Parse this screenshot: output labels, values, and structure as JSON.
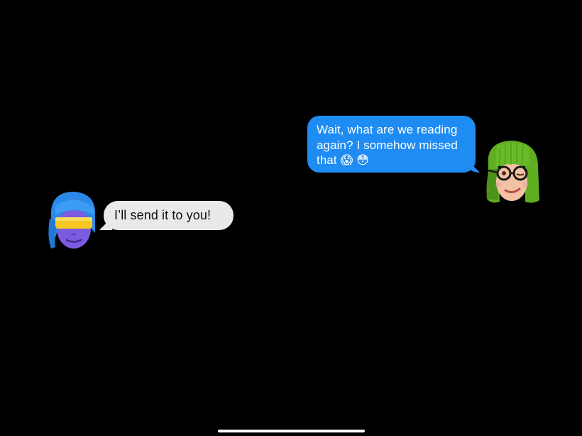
{
  "conversation": {
    "messages": [
      {
        "sender": "friend",
        "text": "Wait, what are we reading again? I somehow missed that 😱 😳",
        "avatar": "memoji-green-hair-glasses-icon"
      },
      {
        "sender": "me",
        "text": "I’ll send it to you!",
        "avatar": "memoji-purple-sunglasses-icon"
      }
    ]
  },
  "colors": {
    "background": "#000000",
    "outgoing_bubble": "#1e8cf3",
    "incoming_bubble": "#e9e9eb",
    "home_indicator": "#ffffff"
  }
}
